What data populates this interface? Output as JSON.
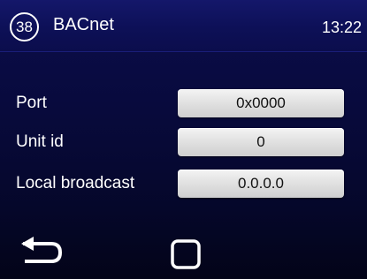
{
  "header": {
    "badge": "38",
    "title": "BACnet",
    "time": "13:22"
  },
  "settings": {
    "port": {
      "label": "Port",
      "value": "0x0000"
    },
    "unit_id": {
      "label": "Unit id",
      "value": "0"
    },
    "local_broadcast": {
      "label": "Local broadcast",
      "value": "0.0.0.0"
    }
  },
  "footer": {
    "back_icon": "back-arrow-icon",
    "home_icon": "square-home-icon"
  },
  "colors": {
    "background_top": "#0b0d4c",
    "background_bottom": "#030418",
    "field": "#e2e2e2",
    "text": "#ffffff"
  }
}
